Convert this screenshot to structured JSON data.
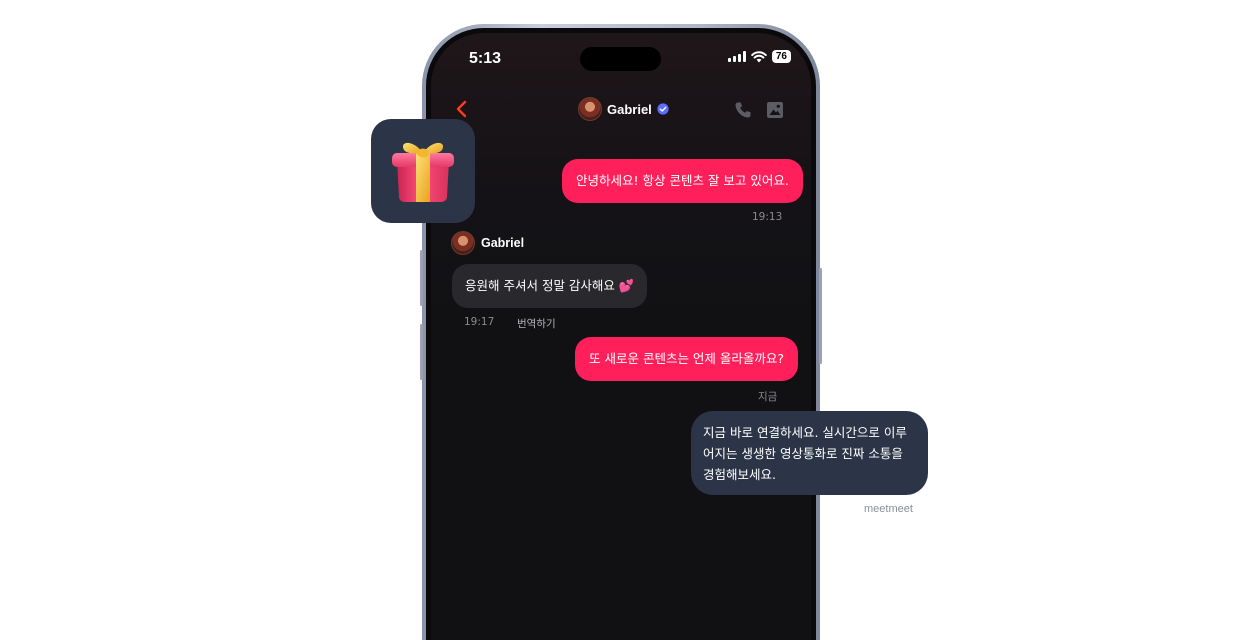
{
  "status_bar": {
    "time": "5:13",
    "battery": "76"
  },
  "header": {
    "name": "Gabriel"
  },
  "messages": [
    {
      "text": "안녕하세요! 항상 콘텐츠 잘 보고 있어요.",
      "time": "19:13"
    },
    {
      "sender": "Gabriel",
      "text": "응원해 주셔서 정말 감사해요 💕",
      "time": "19:17",
      "translate": "번역하기"
    },
    {
      "text": "또 새로운 콘텐츠는 언제 올라올까요?",
      "time": "지금"
    }
  ],
  "promo": {
    "text": "지금 바로 연결하세요. 실시간으로 이루어지는 생생한 영상통화로 진짜 소통을 경험해보세요.",
    "brand": "meetmeet"
  },
  "colors": {
    "accent": "#ff1f5a",
    "tile": "#2b3547",
    "incoming": "#28282d"
  },
  "icons": [
    "back-icon",
    "verified-icon",
    "phone-icon",
    "image-icon",
    "gift-icon"
  ]
}
